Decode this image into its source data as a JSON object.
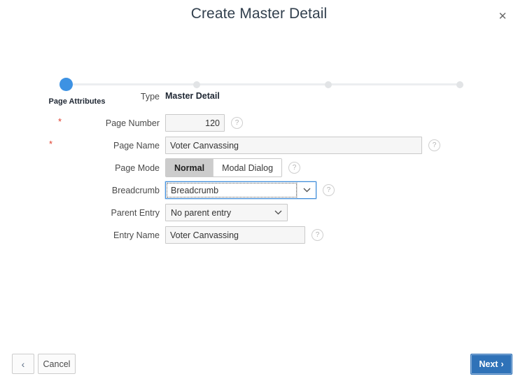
{
  "dialog": {
    "title": "Create Master Detail",
    "close_icon": "close-icon",
    "close_glyph": "✕"
  },
  "wizard": {
    "steps": [
      {
        "label": "Page Attributes",
        "state": "active"
      },
      {
        "label": "",
        "state": "pending"
      },
      {
        "label": "",
        "state": "pending"
      },
      {
        "label": "",
        "state": "pending"
      }
    ]
  },
  "form": {
    "type_row": {
      "label": "Type",
      "value": "Master Detail"
    },
    "page_number": {
      "label": "Page Number",
      "required_marker": "*",
      "value": "120",
      "placeholder": "",
      "help_glyph": "?"
    },
    "page_name": {
      "label": "Page Name",
      "required_marker": "*",
      "value": "Voter Canvassing",
      "placeholder": "",
      "help_glyph": "?"
    },
    "page_mode": {
      "label": "Page Mode",
      "options": [
        "Normal",
        "Modal Dialog"
      ],
      "selected": "Normal",
      "help_glyph": "?"
    },
    "breadcrumb": {
      "label": "Breadcrumb",
      "value": "Breadcrumb",
      "chevron": "⌄",
      "help_glyph": "?"
    },
    "parent_entry": {
      "label": "Parent Entry",
      "value": "No parent entry",
      "chevron": "⌄"
    },
    "entry_name": {
      "label": "Entry Name",
      "value": "Voter Canvassing",
      "placeholder": "",
      "help_glyph": "?"
    }
  },
  "footer": {
    "back_glyph": "‹",
    "cancel_label": "Cancel",
    "next_label": "Next",
    "next_glyph": "›"
  },
  "colors": {
    "accent_blue": "#3d92e3",
    "primary_button": "#2f72b8",
    "required_red": "#e03e2d",
    "title_text": "#32404e"
  }
}
